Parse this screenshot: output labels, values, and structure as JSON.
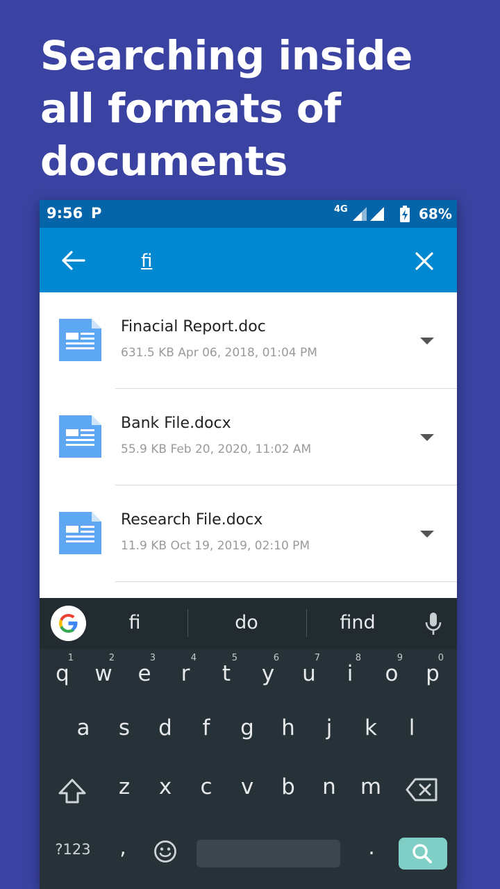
{
  "headline": "Searching inside all formats of documents",
  "status_bar": {
    "time": "9:56",
    "app_glyph": "P",
    "network": "4G",
    "battery": "68%"
  },
  "search": {
    "query": "fi",
    "back_icon": "arrow-left-icon",
    "clear_icon": "close-icon"
  },
  "files": [
    {
      "name": "Finacial Report.doc",
      "meta": "631.5 KB Apr 06, 2018, 01:04 PM",
      "icon": "document-icon"
    },
    {
      "name": "Bank File.docx",
      "meta": "55.9 KB Feb 20, 2020, 11:02 AM",
      "icon": "document-icon"
    },
    {
      "name": "Research File.docx",
      "meta": "11.9 KB Oct 19, 2019, 02:10 PM",
      "icon": "document-icon"
    }
  ],
  "keyboard": {
    "suggestions": [
      "fi",
      "do",
      "find"
    ],
    "row1": [
      {
        "key": "q",
        "hint": "1"
      },
      {
        "key": "w",
        "hint": "2"
      },
      {
        "key": "e",
        "hint": "3"
      },
      {
        "key": "r",
        "hint": "4"
      },
      {
        "key": "t",
        "hint": "5"
      },
      {
        "key": "y",
        "hint": "6"
      },
      {
        "key": "u",
        "hint": "7"
      },
      {
        "key": "i",
        "hint": "8"
      },
      {
        "key": "o",
        "hint": "9"
      },
      {
        "key": "p",
        "hint": "0"
      }
    ],
    "row2": [
      "a",
      "s",
      "d",
      "f",
      "g",
      "h",
      "j",
      "k",
      "l"
    ],
    "row3": [
      "z",
      "x",
      "c",
      "v",
      "b",
      "n",
      "m"
    ],
    "symbols_label": "?123",
    "comma": ",",
    "period": "."
  },
  "colors": {
    "background": "#3a43a1",
    "status_bar": "#0565a8",
    "search_bar": "#0288d1",
    "doc_icon": "#5ea8f3",
    "keyboard": "#263238",
    "search_key": "#7fcfc7"
  }
}
